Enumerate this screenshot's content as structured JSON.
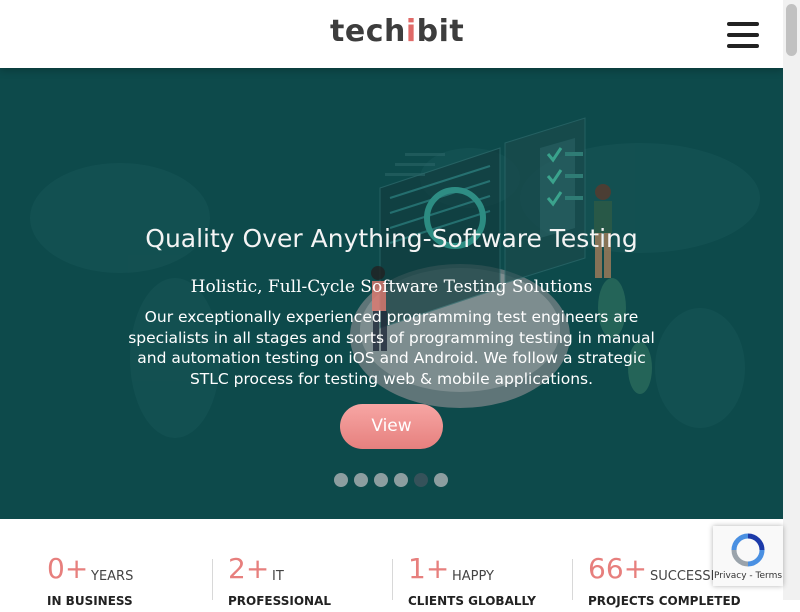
{
  "header": {
    "logo_text_start": "tech",
    "logo_text_accent": "i",
    "logo_text_end": "bit",
    "menu_icon": "hamburger-menu-icon"
  },
  "hero": {
    "title": "Quality Over Anything-Software Testing",
    "subtitle": "Holistic, Full-Cycle Software Testing Solutions",
    "description": "Our exceptionally experienced programming test engineers are specialists in all stages and sorts of programming testing in manual and automation testing on iOS and Android. We follow a strategic STLC process for testing web & mobile applications.",
    "button_label": "View",
    "slide_count": 6,
    "active_slide": 5,
    "background_color": "#0d4a4b"
  },
  "stats": [
    {
      "number": "0+",
      "label1": "YEARS",
      "label2": "IN BUSINESS"
    },
    {
      "number": "2+",
      "label1": "IT",
      "label2": "PROFESSIONAL"
    },
    {
      "number": "1+",
      "label1": "HAPPY",
      "label2": "CLIENTS GLOBALLY"
    },
    {
      "number": "66+",
      "label1": "SUCCESSFUL",
      "label2": "PROJECTS COMPLETED"
    }
  ],
  "recaptcha": {
    "text": "Privacy - Terms",
    "icon": "recaptcha-icon"
  },
  "colors": {
    "accent": "#e77f7d",
    "button": "#ee918f"
  }
}
